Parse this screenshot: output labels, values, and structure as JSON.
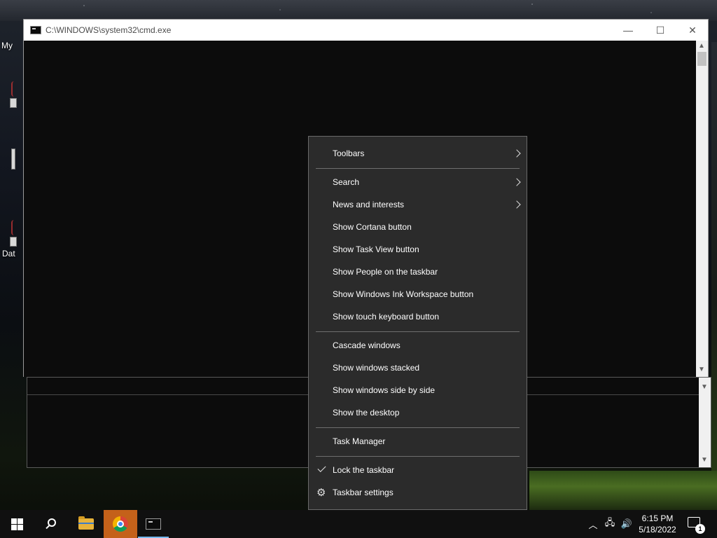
{
  "desktop": {
    "icon_labels": [
      "My",
      "Dat"
    ]
  },
  "cmd_window": {
    "title": "C:\\WINDOWS\\system32\\cmd.exe",
    "minimize_glyph": "—",
    "maximize_glyph": "☐",
    "close_glyph": "✕",
    "scroll_up_glyph": "▲",
    "scroll_down_glyph": "▼",
    "icon": "console-icon"
  },
  "background_window": {
    "scroll_down_glyph": "▼"
  },
  "context_menu": {
    "items": [
      {
        "label": "Toolbars",
        "submenu": true
      },
      {
        "label": "Search",
        "submenu": true
      },
      {
        "label": "News and interests",
        "submenu": true
      },
      {
        "label": "Show Cortana button"
      },
      {
        "label": "Show Task View button"
      },
      {
        "label": "Show People on the taskbar"
      },
      {
        "label": "Show Windows Ink Workspace button"
      },
      {
        "label": "Show touch keyboard button"
      },
      {
        "label": "Cascade windows"
      },
      {
        "label": "Show windows stacked"
      },
      {
        "label": "Show windows side by side"
      },
      {
        "label": "Show the desktop"
      },
      {
        "label": "Task Manager"
      },
      {
        "label": "Lock the taskbar",
        "checked": true
      },
      {
        "label": "Taskbar settings",
        "icon": "gear-icon"
      }
    ],
    "gear_glyph": "⚙"
  },
  "taskbar": {
    "pinned": [
      {
        "name": "start",
        "icon": "windows-logo-icon"
      },
      {
        "name": "search",
        "icon": "search-icon"
      },
      {
        "name": "file-explorer",
        "icon": "folder-icon"
      },
      {
        "name": "chrome",
        "icon": "chrome-icon",
        "highlighted": true
      },
      {
        "name": "command-prompt",
        "icon": "console-icon",
        "active": true
      }
    ],
    "tray": {
      "chevron_glyph": "︿",
      "network_glyph": "🖧",
      "volume_glyph": "🔊",
      "time": "6:15 PM",
      "date": "5/18/2022",
      "notification_count": "1"
    },
    "colors": {
      "chrome_highlight": "#c4611a",
      "active_underline": "#76b9ed"
    }
  }
}
